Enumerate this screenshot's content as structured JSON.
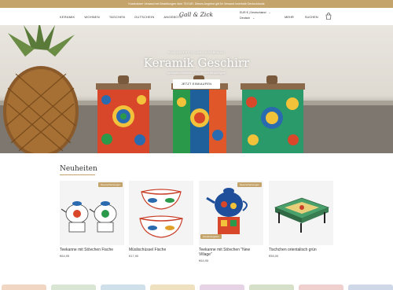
{
  "announcement": "Kostenloser Versand bei Bestellungen über 75 EUR. Dieses Angebot gilt für Versand innerhalb Deutschlands",
  "nav": {
    "items": [
      "KERAMIK",
      "WOHNEN",
      "TASCHEN",
      "GUTSCHEIN",
      "ANGEBOTE"
    ],
    "logo": "Gall & Zick",
    "currency": "EUR € | Deutschland",
    "language": "Deutsch",
    "more": "MEHR",
    "search": "SUCHEN",
    "cart_icon": "bag-icon"
  },
  "hero": {
    "kicker": "HANDGEFERTIGT UND HANDBEMALT",
    "title": "Keramik Geschirr",
    "subtitle": "spülmaschinenfest und mikrowellengeeignet",
    "button": "JETZT EINKAUFEN"
  },
  "section": {
    "title": "Neuheiten"
  },
  "products": [
    {
      "name": "Teekanne mit Stövchen Fische",
      "price": "€64,95",
      "badge": "Neuerscheinungen",
      "sale": ""
    },
    {
      "name": "Müslischüssel Fische",
      "price": "€17,90",
      "badge": "",
      "sale": ""
    },
    {
      "name": "Teekanne mit Stövchen \"New Village\"",
      "price": "€64,95",
      "badge": "Neuerscheinungen",
      "sale": "Sonderangebot"
    },
    {
      "name": "Tischchen orientalisch grün",
      "price": "€55,00",
      "badge": "",
      "sale": ""
    }
  ],
  "colors": {
    "accent": "#c4a46a",
    "strip": [
      "#f2d6c4",
      "#d9e6d3",
      "#cfe0ea",
      "#efe0c0",
      "#e6d3e6",
      "#d6e0c8",
      "#f0cfcf",
      "#cfd8e8"
    ]
  }
}
